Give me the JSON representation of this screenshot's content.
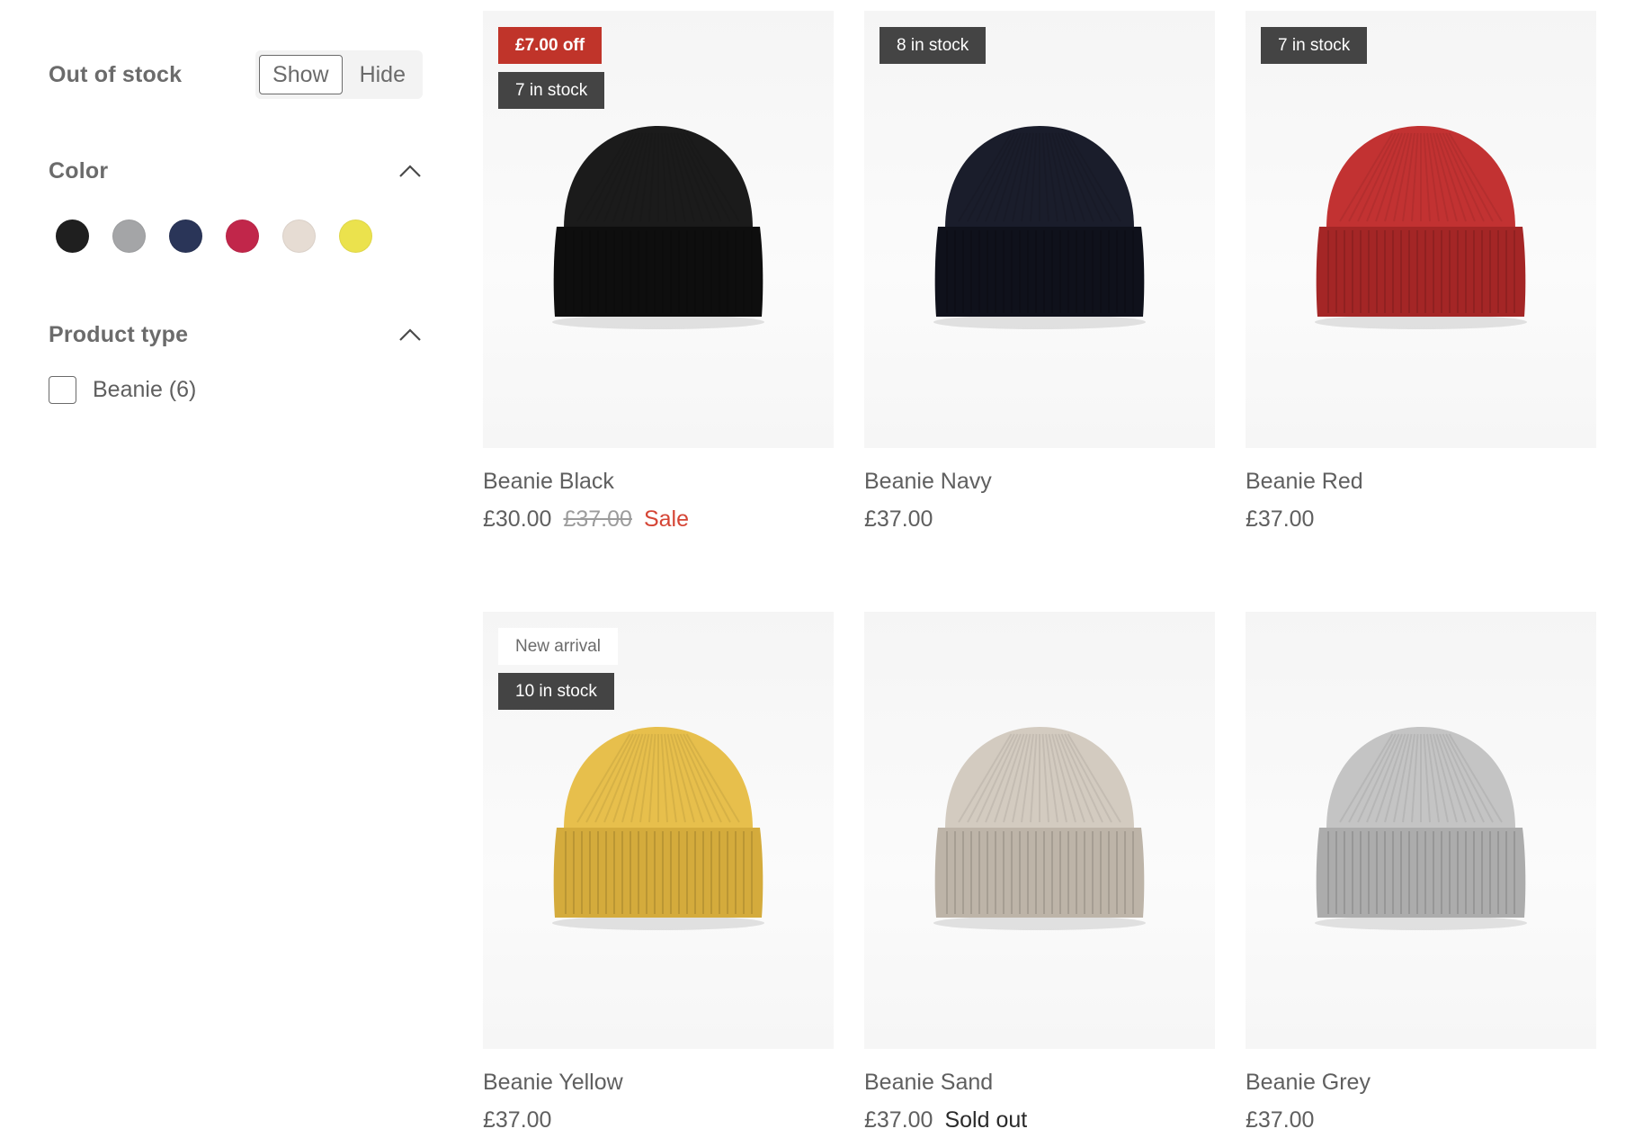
{
  "filters": {
    "out_of_stock": {
      "label": "Out of stock",
      "show_label": "Show",
      "hide_label": "Hide",
      "selected": "Show"
    },
    "color": {
      "label": "Color",
      "swatches": [
        {
          "name": "black",
          "hex": "#1f1f1f"
        },
        {
          "name": "grey",
          "hex": "#a4a5a7"
        },
        {
          "name": "navy",
          "hex": "#2a3558"
        },
        {
          "name": "red",
          "hex": "#c1264a"
        },
        {
          "name": "sand",
          "hex": "#e6dcd3"
        },
        {
          "name": "yellow",
          "hex": "#ebe24d"
        }
      ]
    },
    "product_type": {
      "label": "Product type",
      "options": [
        {
          "label": "Beanie (6)",
          "checked": false
        }
      ]
    }
  },
  "products": [
    {
      "title": "Beanie Black",
      "price": "£30.00",
      "compare_price": "£37.00",
      "sale_label": "Sale",
      "status": "",
      "badges": [
        {
          "text": "£7.00 off",
          "kind": "sale"
        },
        {
          "text": "7 in stock",
          "kind": "stock"
        }
      ],
      "hat_color": "#1b1b1b",
      "hat_shade": "#0e0e0e",
      "hat_icon": "beanie-icon"
    },
    {
      "title": "Beanie Navy",
      "price": "£37.00",
      "compare_price": "",
      "sale_label": "",
      "status": "",
      "badges": [
        {
          "text": "8 in stock",
          "kind": "stock"
        }
      ],
      "hat_color": "#1a1d2b",
      "hat_shade": "#0f111b",
      "hat_icon": "beanie-icon"
    },
    {
      "title": "Beanie Red",
      "price": "£37.00",
      "compare_price": "",
      "sale_label": "",
      "status": "",
      "badges": [
        {
          "text": "7 in stock",
          "kind": "stock"
        }
      ],
      "hat_color": "#c23232",
      "hat_shade": "#a42626",
      "hat_icon": "beanie-icon"
    },
    {
      "title": "Beanie Yellow",
      "price": "£37.00",
      "compare_price": "",
      "sale_label": "",
      "status": "",
      "badges": [
        {
          "text": "New arrival",
          "kind": "new"
        },
        {
          "text": "10 in stock",
          "kind": "stock"
        }
      ],
      "hat_color": "#e7bf4c",
      "hat_shade": "#d4ab3c",
      "hat_icon": "beanie-icon"
    },
    {
      "title": "Beanie Sand",
      "price": "£37.00",
      "compare_price": "",
      "sale_label": "",
      "status": "Sold out",
      "badges": [],
      "hat_color": "#d3cbc0",
      "hat_shade": "#bdb4a8",
      "hat_icon": "beanie-icon"
    },
    {
      "title": "Beanie Grey",
      "price": "£37.00",
      "compare_price": "",
      "sale_label": "",
      "status": "",
      "badges": [],
      "hat_color": "#c4c4c4",
      "hat_shade": "#acacac",
      "hat_icon": "beanie-icon"
    }
  ]
}
